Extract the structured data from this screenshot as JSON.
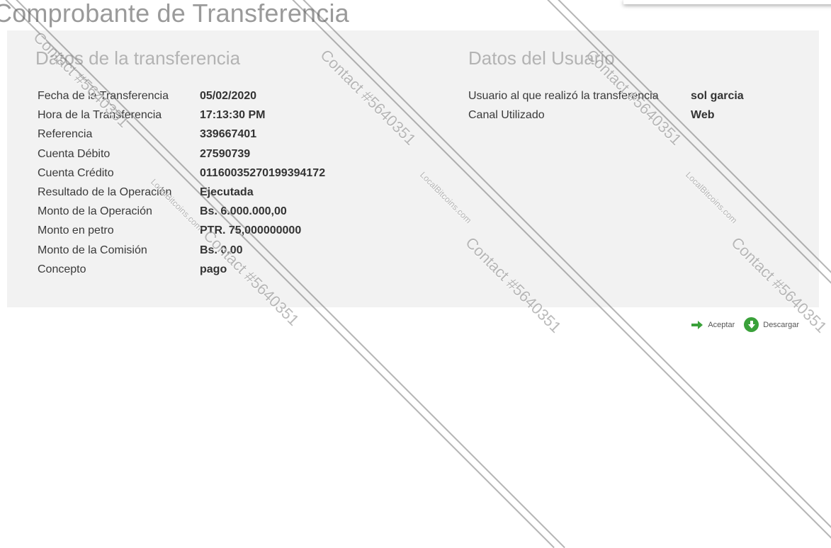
{
  "page": {
    "title": "Comprobante de Transferencia"
  },
  "transfer": {
    "title": "Datos de la transferencia",
    "rows": [
      {
        "label": "Fecha de la Transferencia",
        "value": "05/02/2020"
      },
      {
        "label": "Hora de la Transferencia",
        "value": "17:13:30 PM"
      },
      {
        "label": "Referencia",
        "value": "339667401"
      },
      {
        "label": "Cuenta Débito",
        "value": "27590739"
      },
      {
        "label": "Cuenta Crédito",
        "value": "01160035270199394172"
      },
      {
        "label": "Resultado de la Operación",
        "value": "Ejecutada"
      },
      {
        "label": "Monto de la Operación",
        "value": "Bs. 6.000.000,00"
      },
      {
        "label": "Monto en petro",
        "value": "PTR. 75,000000000"
      },
      {
        "label": "Monto de la Comisión",
        "value": "Bs. 0,00"
      },
      {
        "label": "Concepto",
        "value": "pago"
      }
    ]
  },
  "user": {
    "title": "Datos del Usuario",
    "rows": [
      {
        "label": "Usuario al que realizó la transferencia",
        "value": "sol garcia"
      },
      {
        "label": "Canal Utilizado",
        "value": "Web"
      }
    ]
  },
  "footer": {
    "accept_label": "Aceptar",
    "download_label": "Descargar",
    "accept_icon": "arrow-right-icon",
    "download_icon": "download-icon",
    "accent_color": "#3aa13a"
  },
  "watermark": {
    "text": "Contact #5640351",
    "site": "LocalBitcoins.com"
  }
}
